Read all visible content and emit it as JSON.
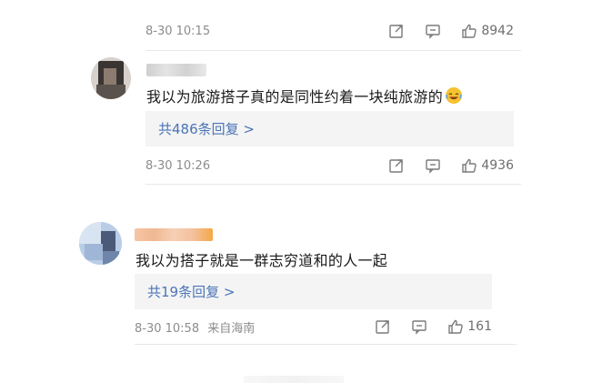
{
  "comments": [
    {
      "timestamp": "8-30 10:15",
      "location": "",
      "likes": "8942"
    },
    {
      "timestamp": "8-30 10:26",
      "location": "",
      "likes": "4936",
      "text": "我以为旅游搭子真的是同性约着一块纯旅游的",
      "replies_label": "共486条回复 >"
    },
    {
      "timestamp": "8-30 10:58",
      "location": "来自海南",
      "likes": "161",
      "text": "我以为搭子就是一群志穷道和的人一起",
      "replies_label": "共19条回复 >"
    }
  ],
  "colors": {
    "link": "#4b74b6",
    "meta": "#8c8c8c",
    "reply_bg": "#f4f4f4"
  },
  "icons": [
    "share-icon",
    "comment-icon",
    "like-icon",
    "laughing-emoji"
  ]
}
